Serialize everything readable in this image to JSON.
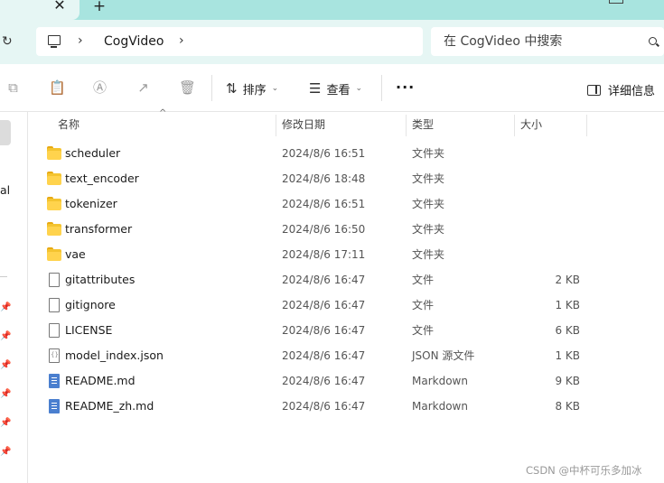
{
  "window": {
    "tab_close_glyph": "✕",
    "tab_new_glyph": "+"
  },
  "address": {
    "path": "CogVideo",
    "search_placeholder": "在 CogVideo 中搜索"
  },
  "toolbar": {
    "sort_label": "排序",
    "view_label": "查看",
    "more_label": "···",
    "details_label": "详细信息"
  },
  "sidebar": {
    "partial_text": "al"
  },
  "columns": {
    "name": "名称",
    "date": "修改日期",
    "type": "类型",
    "size": "大小"
  },
  "files": [
    {
      "name": "scheduler",
      "date": "2024/8/6 16:51",
      "type": "文件夹",
      "size": "",
      "icon": "folder-icon"
    },
    {
      "name": "text_encoder",
      "date": "2024/8/6 18:48",
      "type": "文件夹",
      "size": "",
      "icon": "folder-icon"
    },
    {
      "name": "tokenizer",
      "date": "2024/8/6 16:51",
      "type": "文件夹",
      "size": "",
      "icon": "folder-icon"
    },
    {
      "name": "transformer",
      "date": "2024/8/6 16:50",
      "type": "文件夹",
      "size": "",
      "icon": "folder-icon"
    },
    {
      "name": "vae",
      "date": "2024/8/6 17:11",
      "type": "文件夹",
      "size": "",
      "icon": "folder-icon"
    },
    {
      "name": "gitattributes",
      "date": "2024/8/6 16:47",
      "type": "文件",
      "size": "2 KB",
      "icon": "file-icon"
    },
    {
      "name": "gitignore",
      "date": "2024/8/6 16:47",
      "type": "文件",
      "size": "1 KB",
      "icon": "file-icon"
    },
    {
      "name": "LICENSE",
      "date": "2024/8/6 16:47",
      "type": "文件",
      "size": "6 KB",
      "icon": "file-icon"
    },
    {
      "name": "model_index.json",
      "date": "2024/8/6 16:47",
      "type": "JSON 源文件",
      "size": "1 KB",
      "icon": "json-file-icon"
    },
    {
      "name": "README.md",
      "date": "2024/8/6 16:47",
      "type": "Markdown",
      "size": "9 KB",
      "icon": "markdown-file-icon"
    },
    {
      "name": "README_zh.md",
      "date": "2024/8/6 16:47",
      "type": "Markdown",
      "size": "8 KB",
      "icon": "markdown-file-icon"
    }
  ],
  "watermark": "CSDN @中杯可乐多加冰"
}
